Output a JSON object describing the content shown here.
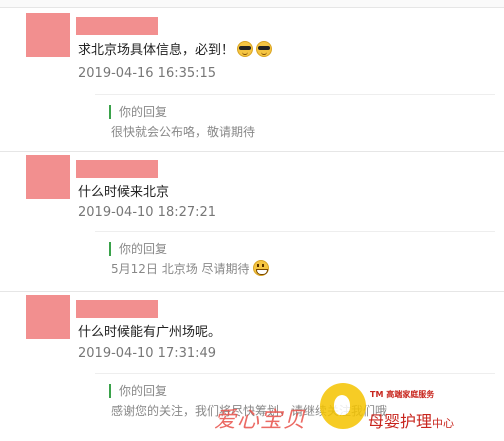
{
  "comments": [
    {
      "text": "求北京场具体信息，必到！",
      "emojis": [
        "sunglasses-emoji",
        "sunglasses-emoji"
      ],
      "date": "2019-04-16 16:35:15",
      "reply": {
        "title": "你的回复",
        "text": "很快就会公布咯，敬请期待"
      }
    },
    {
      "text": "什么时候来北京",
      "date": "2019-04-10 18:27:21",
      "reply": {
        "title": "你的回复",
        "text": "5月12日 北京场 尽请期待",
        "emoji": "grin-emoji"
      }
    },
    {
      "text": "什么时候能有广州场呢。",
      "date": "2019-04-10 17:31:49",
      "reply": {
        "title": "你的回复",
        "text": "感谢您的关注，我们将尽快筹划，请继续关注我们哦"
      }
    }
  ],
  "watermark": {
    "brand": "爱心宝贝",
    "tm_line": "TM 高端家庭服务",
    "service": "母婴护理",
    "center": "中心"
  },
  "colors": {
    "avatar_placeholder": "#f28f8f",
    "reply_bar": "#3aa24a",
    "watermark_red": "#c8261e",
    "watermark_yellow": "#f5c400"
  }
}
